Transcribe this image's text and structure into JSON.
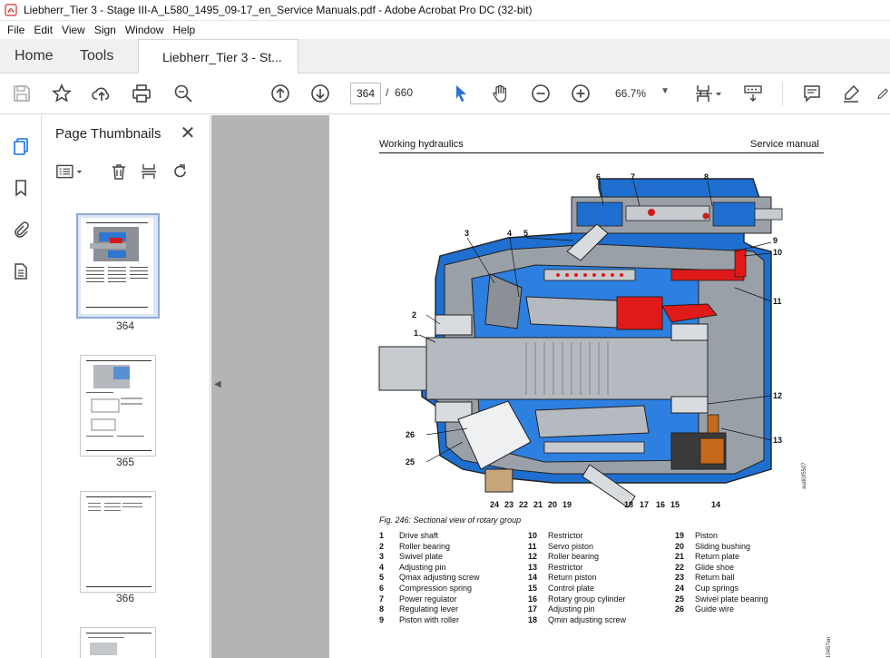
{
  "window": {
    "title": "Liebherr_Tier 3 - Stage III-A_L580_1495_09-17_en_Service Manuals.pdf - Adobe Acrobat Pro DC (32-bit)"
  },
  "menu": [
    "File",
    "Edit",
    "View",
    "Sign",
    "Window",
    "Help"
  ],
  "tabs": {
    "home": "Home",
    "tools": "Tools",
    "document": "Liebherr_Tier 3 - St..."
  },
  "toolbar": {
    "current_page": "364",
    "separator": "/",
    "total_pages": "660",
    "zoom": "66.7%"
  },
  "panel": {
    "title": "Page Thumbnails",
    "thumbnails": [
      {
        "label": "364",
        "selected": true
      },
      {
        "label": "365",
        "selected": false
      },
      {
        "label": "366",
        "selected": false
      }
    ]
  },
  "page": {
    "header_left": "Working hydraulics",
    "header_right": "Service manual",
    "caption": "Fig. 246: Sectional view of rotary group",
    "figure_code": "audi0f5507",
    "side_code": "10457en",
    "callouts": [
      "1",
      "2",
      "3",
      "4",
      "5",
      "6",
      "7",
      "8",
      "9",
      "10",
      "11",
      "12",
      "13",
      "14",
      "15",
      "16",
      "17",
      "18",
      "19",
      "20",
      "21",
      "22",
      "23",
      "24",
      "25",
      "26"
    ],
    "legend": [
      [
        {
          "num": "1",
          "text": "Drive shaft"
        },
        {
          "num": "2",
          "text": "Roller bearing"
        },
        {
          "num": "3",
          "text": "Swivel plate"
        },
        {
          "num": "4",
          "text": "Adjusting pin"
        },
        {
          "num": "5",
          "text": "Qmax adjusting screw"
        },
        {
          "num": "6",
          "text": "Compression spring"
        },
        {
          "num": "7",
          "text": "Power regulator"
        },
        {
          "num": "8",
          "text": "Regulating lever"
        },
        {
          "num": "9",
          "text": "Piston with roller"
        }
      ],
      [
        {
          "num": "10",
          "text": "Restrictor"
        },
        {
          "num": "11",
          "text": "Servo piston"
        },
        {
          "num": "12",
          "text": "Roller bearing"
        },
        {
          "num": "13",
          "text": "Restrictor"
        },
        {
          "num": "14",
          "text": "Return piston"
        },
        {
          "num": "15",
          "text": "Control plate"
        },
        {
          "num": "16",
          "text": "Rotary group cylinder"
        },
        {
          "num": "17",
          "text": "Adjusting pin"
        },
        {
          "num": "18",
          "text": "Qmin adjusting screw"
        }
      ],
      [
        {
          "num": "19",
          "text": "Piston"
        },
        {
          "num": "20",
          "text": "Sliding bushing"
        },
        {
          "num": "21",
          "text": "Return plate"
        },
        {
          "num": "22",
          "text": "Glide shoe"
        },
        {
          "num": "23",
          "text": "Return ball"
        },
        {
          "num": "24",
          "text": "Cup springs"
        },
        {
          "num": "25",
          "text": "Swivel plate bearing"
        },
        {
          "num": "26",
          "text": "Guide wire"
        }
      ]
    ]
  }
}
